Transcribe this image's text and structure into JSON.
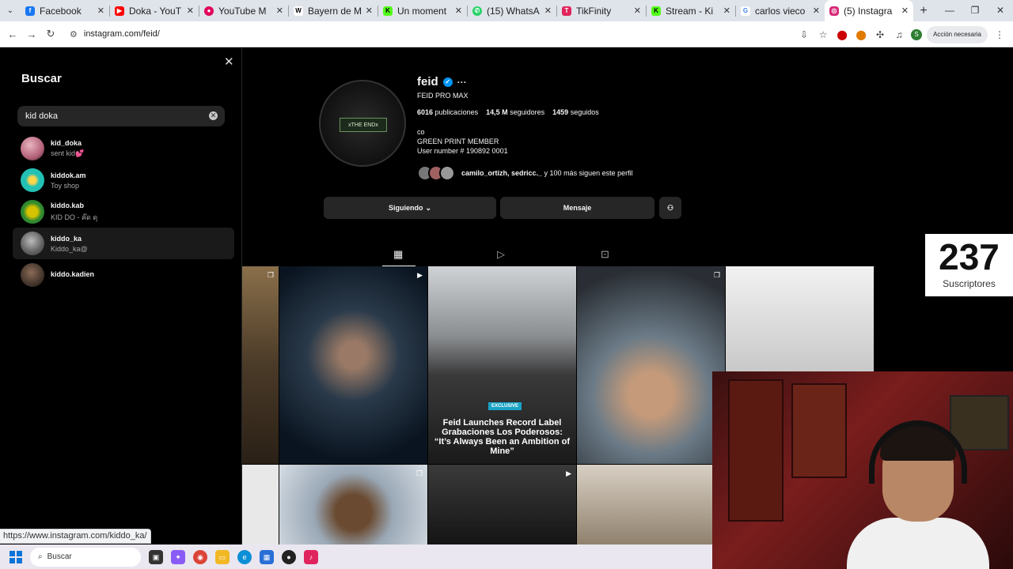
{
  "browser": {
    "tabs": [
      {
        "title": "Facebook",
        "favicon_color": "#1877f2",
        "glyph": "f"
      },
      {
        "title": "Doka - YouT",
        "favicon_color": "#ff0000",
        "glyph": "▶"
      },
      {
        "title": "YouTube M",
        "favicon_color": "#e1005a",
        "glyph": "●"
      },
      {
        "title": "Bayern de M",
        "favicon_color": "#ffffff",
        "glyph": "W"
      },
      {
        "title": "Un moment",
        "favicon_color": "#53fc18",
        "glyph": "K"
      },
      {
        "title": "(15) WhatsA",
        "favicon_color": "#25d366",
        "glyph": "✆"
      },
      {
        "title": "TikFinity",
        "favicon_color": "#e0245e",
        "glyph": "T"
      },
      {
        "title": "Stream - Ki",
        "favicon_color": "#53fc18",
        "glyph": "K"
      },
      {
        "title": "carlos vieco",
        "favicon_color": "#4285f4",
        "glyph": "G"
      },
      {
        "title": "(5) Instagra",
        "favicon_color": "#d62976",
        "glyph": "◎"
      }
    ],
    "url": "instagram.com/feid/",
    "action_label": "Acción necesaria",
    "profile_initial": "S"
  },
  "search": {
    "title": "Buscar",
    "query": "kid doka",
    "results": [
      {
        "username": "kid_doka",
        "subtitle": "sent kid💕",
        "avatar_color": "#b4637a"
      },
      {
        "username": "kiddok.am",
        "subtitle": "Toy shop",
        "avatar_color": "#23c1b5"
      },
      {
        "username": "kiddo.kab",
        "subtitle": "KID DO - ค๊ด ดุ",
        "avatar_color": "#d6c200"
      },
      {
        "username": "kiddo_ka",
        "subtitle": "Kiddo_ka@",
        "avatar_color": "#777777"
      },
      {
        "username": "kiddo.kadien",
        "subtitle": "",
        "avatar_color": "#4a3a30"
      }
    ]
  },
  "profile": {
    "username": "feid",
    "full_name": "FEID PRO MAX",
    "posts_count": "6016",
    "posts_label": "publicaciones",
    "followers_count": "14,5 M",
    "followers_label": "seguidores",
    "following_count": "1459",
    "following_label": "seguidos",
    "bio_lines": [
      "co",
      "GREEN PRINT MEMBER",
      "User number # 190892 0001"
    ],
    "avatar_sign_text": "xTHE ENDx",
    "followed_by_names": "camilo_ortizh, sedricc._",
    "followed_by_rest": " y 100 más siguen este perfil",
    "following_button": "Siguiendo",
    "message_button": "Mensaje",
    "post_headline": "Feid Launches Record Label Grabaciones Los Poderosos: “It’s Always Been an Ambition of Mine”",
    "post_tag": "EXCLUSIVE"
  },
  "overlay": {
    "subscriber_count": "237",
    "subscriber_label": "Suscriptores"
  },
  "status_bar": {
    "hover_url": "https://www.instagram.com/kiddo_ka/"
  },
  "taskbar": {
    "search_label": "Buscar"
  }
}
